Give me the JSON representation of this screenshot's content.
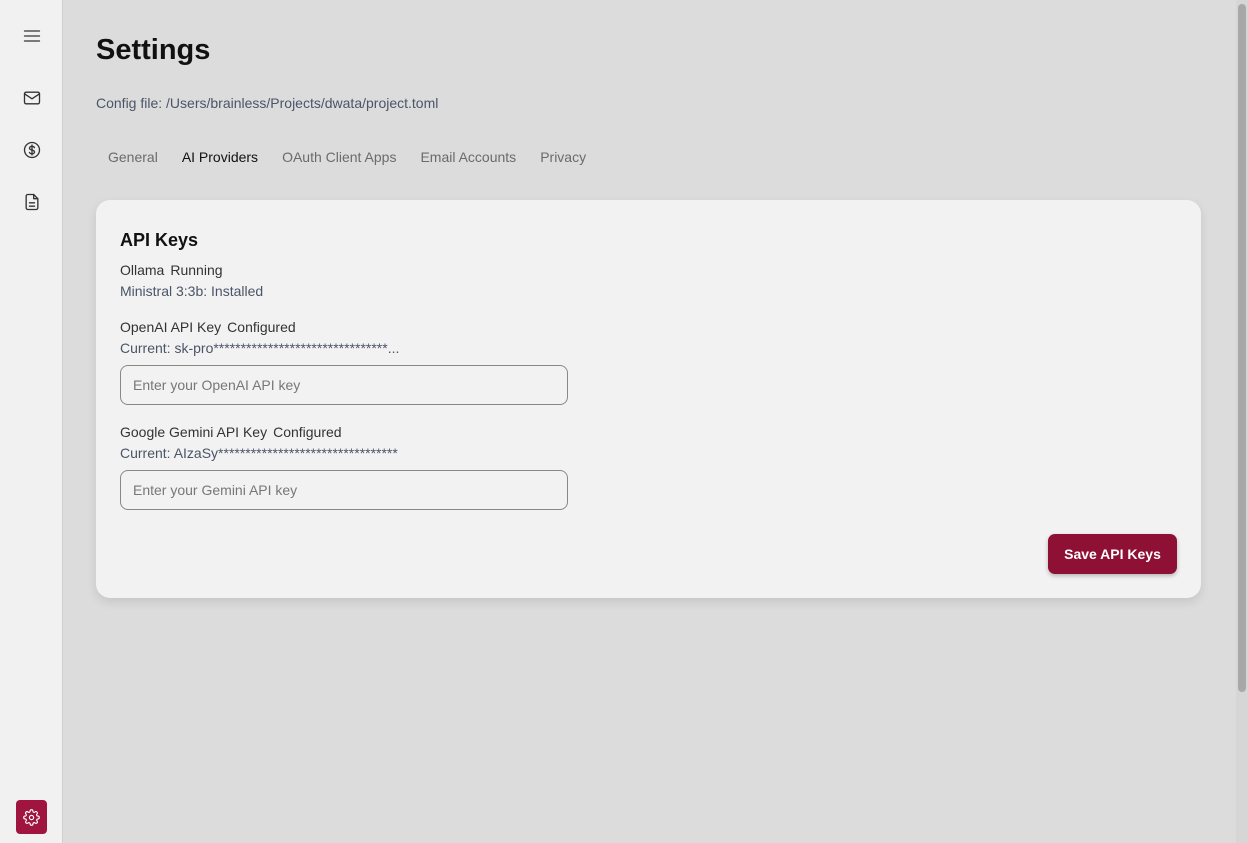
{
  "sidebar": {
    "items": [
      {
        "icon": "menu-icon"
      },
      {
        "icon": "mail-icon"
      },
      {
        "icon": "dollar-icon"
      },
      {
        "icon": "document-icon"
      }
    ],
    "settings_icon": "gear-icon",
    "accent_color": "#a01440"
  },
  "page": {
    "title": "Settings",
    "config_file": "Config file: /Users/brainless/Projects/dwata/project.toml"
  },
  "tabs": [
    {
      "label": "General",
      "active": false
    },
    {
      "label": "AI Providers",
      "active": true
    },
    {
      "label": "OAuth Client Apps",
      "active": false
    },
    {
      "label": "Email Accounts",
      "active": false
    },
    {
      "label": "Privacy",
      "active": false
    }
  ],
  "card": {
    "title": "API Keys",
    "ollama": {
      "label": "Ollama",
      "status": "Running",
      "model_status": "Ministral 3:3b: Installed"
    },
    "openai": {
      "label": "OpenAI API Key",
      "status": "Configured",
      "current": "Current: sk-pro********************************...",
      "placeholder": "Enter your OpenAI API key"
    },
    "gemini": {
      "label": "Google Gemini API Key",
      "status": "Configured",
      "current": "Current: AIzaSy*********************************",
      "placeholder": "Enter your Gemini API key"
    },
    "save_label": "Save API Keys",
    "save_color": "#8e1034"
  }
}
